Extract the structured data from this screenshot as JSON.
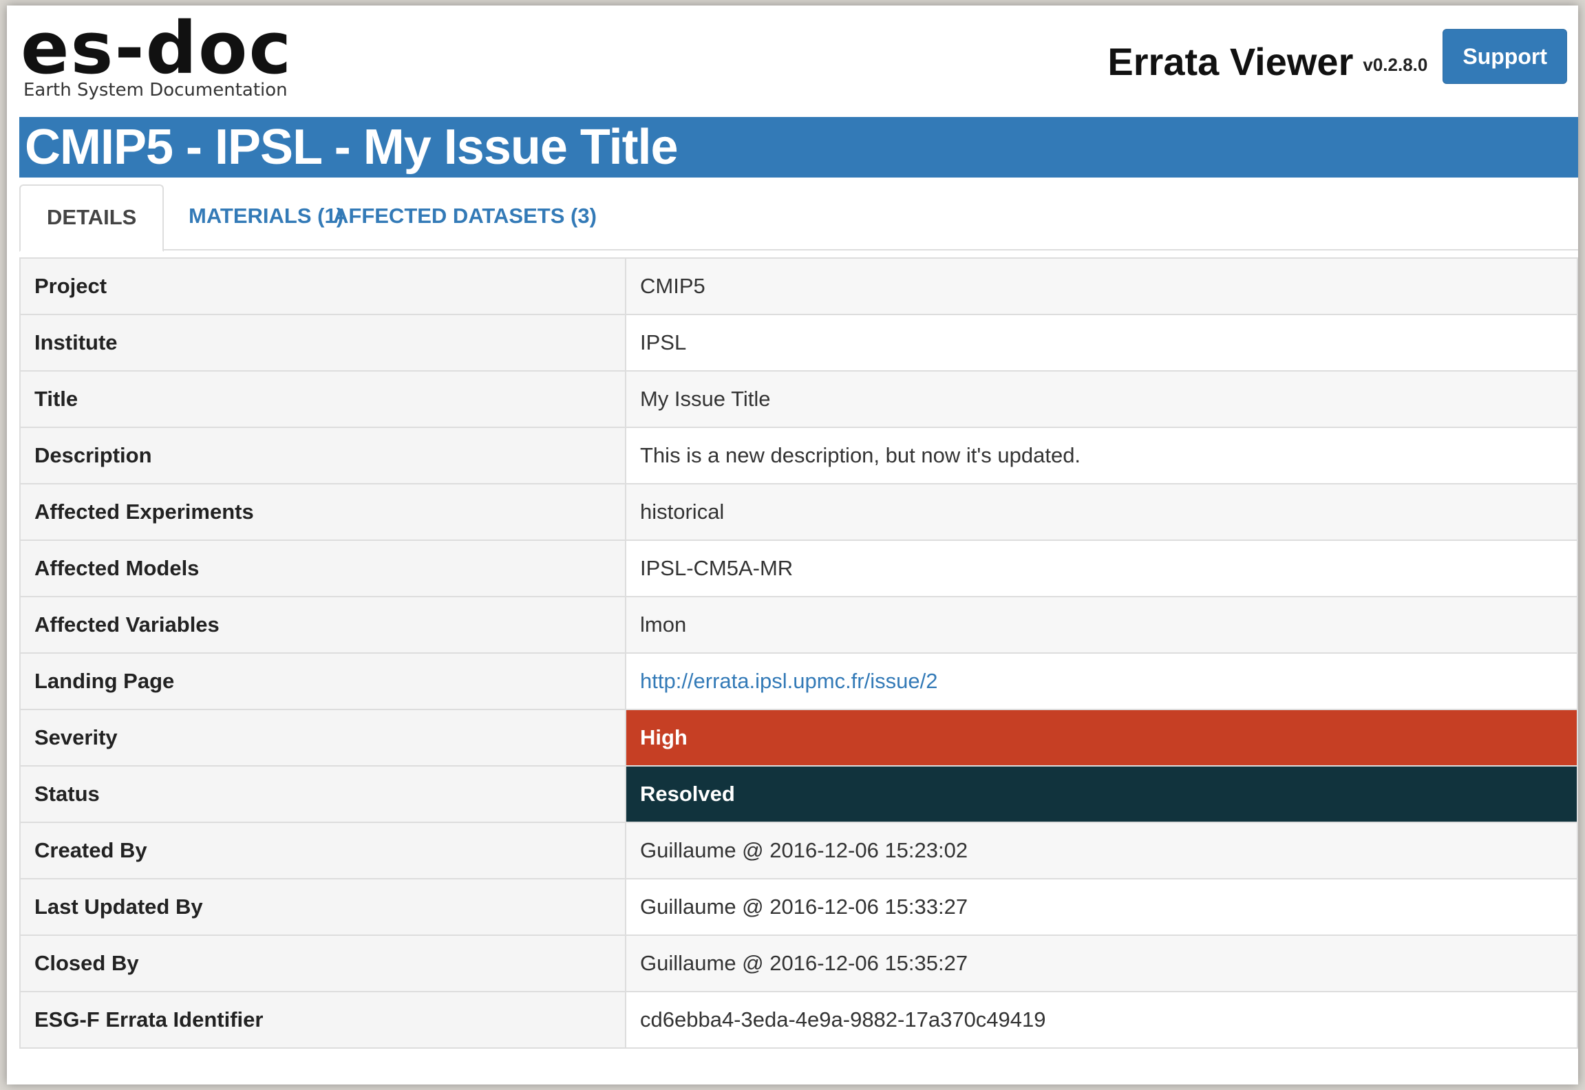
{
  "logo": {
    "main": "es-doc",
    "sub": "Earth System Documentation"
  },
  "header": {
    "app_name": "Errata Viewer",
    "version": "v0.2.8.0",
    "support_label": "Support"
  },
  "title": "CMIP5 - IPSL - My Issue Title",
  "tabs": [
    {
      "label": "DETAILS",
      "active": true
    },
    {
      "label": "MATERIALS (1)",
      "active": false
    },
    {
      "label": "AFFECTED DATASETS (3)",
      "active": false
    }
  ],
  "details": [
    {
      "key": "Project",
      "value": "CMIP5"
    },
    {
      "key": "Institute",
      "value": "IPSL"
    },
    {
      "key": "Title",
      "value": "My Issue Title"
    },
    {
      "key": "Description",
      "value": "This is a new description, but now it's updated."
    },
    {
      "key": "Affected Experiments",
      "value": "historical"
    },
    {
      "key": "Affected Models",
      "value": "IPSL-CM5A-MR"
    },
    {
      "key": "Affected Variables",
      "value": "lmon"
    },
    {
      "key": "Landing Page",
      "value": "http://errata.ipsl.upmc.fr/issue/2"
    },
    {
      "key": "Severity",
      "value": "High"
    },
    {
      "key": "Status",
      "value": "Resolved"
    },
    {
      "key": "Created By",
      "value": "Guillaume @ 2016-12-06 15:23:02"
    },
    {
      "key": "Last Updated By",
      "value": "Guillaume @ 2016-12-06 15:33:27"
    },
    {
      "key": "Closed By",
      "value": "Guillaume @ 2016-12-06 15:35:27"
    },
    {
      "key": "ESG-F Errata Identifier",
      "value": "cd6ebba4-3eda-4e9a-9882-17a370c49419"
    }
  ],
  "colors": {
    "brand_blue": "#337ab7",
    "severity_high": "#c63f24",
    "status_resolved": "#11333d"
  }
}
